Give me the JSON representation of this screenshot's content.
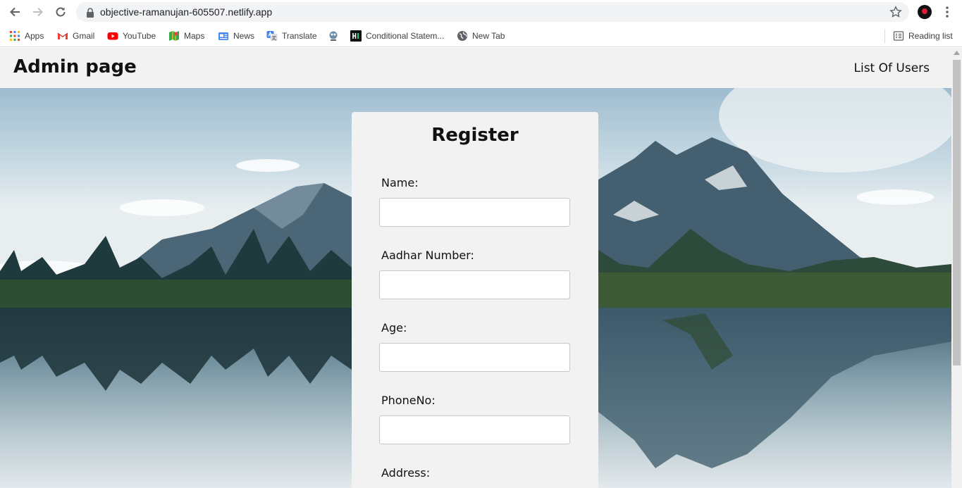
{
  "browser": {
    "url": "objective-ramanujan-605507.netlify.app",
    "bookmarks": [
      {
        "label": "Apps",
        "icon": "apps-grid-icon"
      },
      {
        "label": "Gmail",
        "icon": "gmail-icon"
      },
      {
        "label": "YouTube",
        "icon": "youtube-icon"
      },
      {
        "label": "Maps",
        "icon": "maps-icon"
      },
      {
        "label": "News",
        "icon": "news-icon"
      },
      {
        "label": "Translate",
        "icon": "translate-icon"
      },
      {
        "label": "",
        "icon": "bookmark-favicon-icon"
      },
      {
        "label": "Conditional Statem...",
        "icon": "hackerrank-icon"
      },
      {
        "label": "New Tab",
        "icon": "globe-icon"
      }
    ],
    "reading_list": "Reading list"
  },
  "header": {
    "title": "Admin page",
    "nav_link": "List Of Users"
  },
  "register": {
    "title": "Register",
    "fields": [
      {
        "label": "Name:",
        "value": ""
      },
      {
        "label": "Aadhar Number:",
        "value": ""
      },
      {
        "label": "Age:",
        "value": ""
      },
      {
        "label": "PhoneNo:",
        "value": ""
      },
      {
        "label": "Address:",
        "value": ""
      }
    ]
  },
  "colors": {
    "page_header_bg": "#f2f2f2",
    "card_bg": "#f2f2f2",
    "text": "#111111"
  }
}
